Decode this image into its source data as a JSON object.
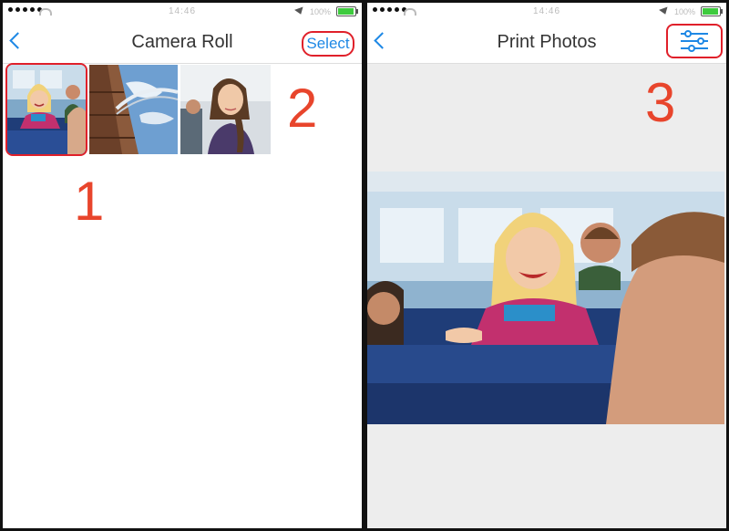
{
  "left_screen": {
    "status_bar": {
      "time": "14:46",
      "battery": "100%"
    },
    "nav": {
      "title": "Camera Roll",
      "select_label": "Select"
    },
    "thumbnails": [
      {
        "name": "girl-on-bus"
      },
      {
        "name": "bridge-sky"
      },
      {
        "name": "woman-portrait"
      }
    ]
  },
  "right_screen": {
    "status_bar": {
      "time": "14:46",
      "battery": "100%"
    },
    "nav": {
      "title": "Print Photos"
    }
  },
  "steps": [
    "1",
    "2",
    "3"
  ],
  "colors": {
    "accent_blue": "#1e88e5",
    "highlight_red": "#e0202a",
    "step_orange": "#e8452c",
    "battery_green": "#3ecb3e"
  },
  "icons": [
    "back-chevron-icon",
    "sliders-settings-icon",
    "wifi-icon",
    "location-arrow-icon",
    "battery-icon"
  ]
}
